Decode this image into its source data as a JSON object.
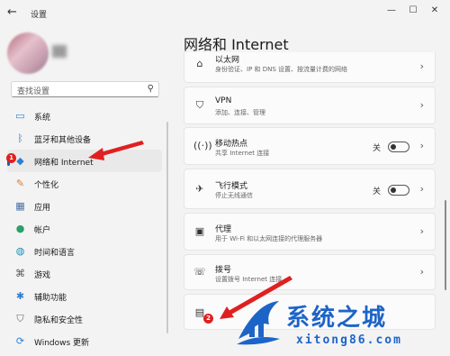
{
  "window": {
    "title": "设置"
  },
  "search": {
    "placeholder": "查找设置"
  },
  "nav": [
    {
      "label": "系统",
      "icon": "monitor-icon"
    },
    {
      "label": "蓝牙和其他设备",
      "icon": "bluetooth-icon"
    },
    {
      "label": "网络和 Internet",
      "icon": "wifi-icon",
      "active": true
    },
    {
      "label": "个性化",
      "icon": "brush-icon"
    },
    {
      "label": "应用",
      "icon": "apps-icon"
    },
    {
      "label": "帐户",
      "icon": "account-icon"
    },
    {
      "label": "时间和语言",
      "icon": "globe-clock-icon"
    },
    {
      "label": "游戏",
      "icon": "gamepad-icon"
    },
    {
      "label": "辅助功能",
      "icon": "accessibility-icon"
    },
    {
      "label": "隐私和安全性",
      "icon": "shield-icon"
    },
    {
      "label": "Windows 更新",
      "icon": "update-icon"
    }
  ],
  "main": {
    "title": "网络和 Internet",
    "cards": [
      {
        "title": "以太网",
        "subtitle": "身份验证、IP 和 DNS 设置、按流量计费的网络",
        "icon": "ethernet-icon"
      },
      {
        "title": "VPN",
        "subtitle": "添加、连接、管理",
        "icon": "vpn-shield-icon"
      },
      {
        "title": "移动热点",
        "subtitle": "共享 Internet 连接",
        "icon": "hotspot-icon",
        "toggle": "关"
      },
      {
        "title": "飞行模式",
        "subtitle": "停止无线通信",
        "icon": "airplane-icon",
        "toggle": "关"
      },
      {
        "title": "代理",
        "subtitle": "用于 Wi-Fi 和以太网连接的代理服务器",
        "icon": "proxy-icon"
      },
      {
        "title": "拨号",
        "subtitle": "设置拨号 Internet 连接",
        "icon": "dialup-icon"
      },
      {
        "title": "",
        "subtitle": "",
        "icon": "network-computer-icon"
      }
    ]
  },
  "badges": {
    "first": "1",
    "second": "2"
  },
  "watermark": {
    "text": "系统之城",
    "sub": "xitong86.com"
  },
  "colors": {
    "accent": "#0067c0",
    "arrow": "#e02020",
    "watermark": "#1d64c8"
  }
}
